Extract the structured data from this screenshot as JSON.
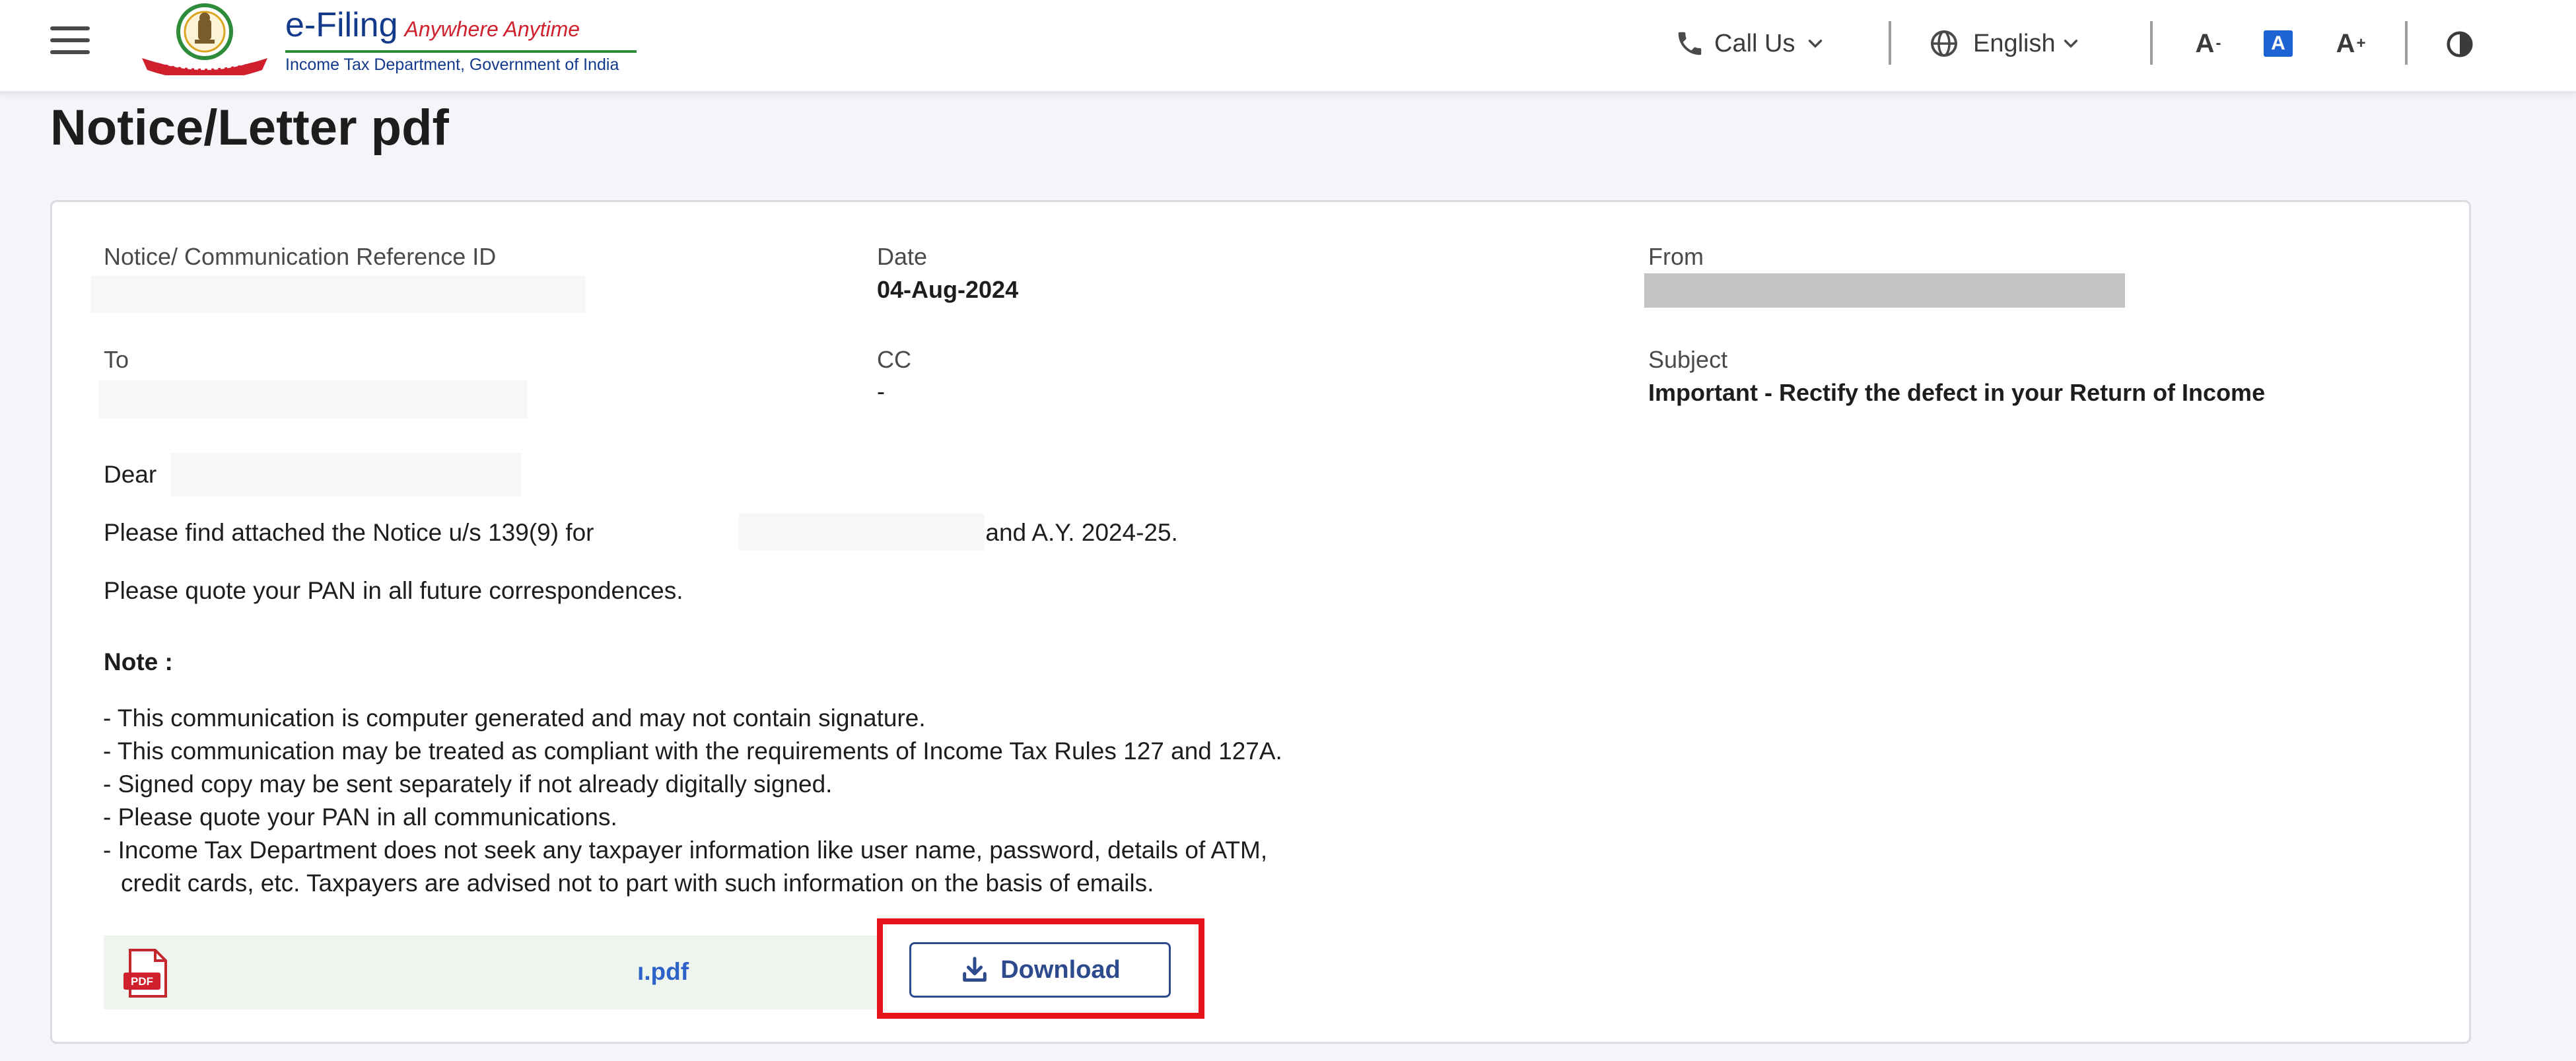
{
  "header": {
    "brand_title": "e-Filing",
    "brand_tagline": "Anywhere Anytime",
    "brand_subtitle": "Income Tax Department, Government of India",
    "call_us_label": "Call Us",
    "language_label": "English",
    "font_decrease_label": "A",
    "font_decrease_mark": "-",
    "font_normal_label": "A",
    "font_increase_label": "A",
    "font_increase_mark": "+",
    "icons": {
      "menu": "hamburger-menu-icon",
      "call": "phone-icon",
      "language": "globe-icon",
      "chevron": "chevron-down-icon",
      "contrast": "contrast-icon"
    }
  },
  "page": {
    "title": "Notice/Letter pdf"
  },
  "details": {
    "reference_label": "Notice/ Communication Reference ID",
    "date_label": "Date",
    "date_value": "04-Aug-2024",
    "from_label": "From",
    "to_label": "To",
    "cc_label": "CC",
    "cc_value": "-",
    "subject_label": "Subject",
    "subject_value": "Important - Rectify the defect in your Return of Income"
  },
  "letter": {
    "greeting": "Dear",
    "line1_prefix": "Please find attached the Notice u/s 139(9) for",
    "line1_suffix": "  and A.Y. 2024-25.",
    "line2": "Please quote your PAN in all future correspondences.",
    "note_title": "Note :",
    "notes": [
      "- This communication is computer generated and may not contain signature.",
      "- This communication may be treated as compliant with the requirements of Income Tax Rules 127 and 127A.",
      "- Signed copy may be sent separately if not already digitally signed.",
      "- Please quote your PAN in all communications.",
      "- Income Tax Department does not seek any taxpayer information like user name, password, details of ATM,"
    ],
    "note_continuation": "credit cards, etc. Taxpayers are advised not to part with such information on the basis of emails."
  },
  "attachment": {
    "file_name": "ı.pdf",
    "pdf_badge": "PDF",
    "download_label": "Download",
    "icons": {
      "file": "pdf-file-icon",
      "download": "download-icon"
    }
  },
  "colors": {
    "brand_blue": "#133a8b",
    "brand_red": "#d0202e",
    "link_blue": "#2d63c8",
    "button_navy": "#2c4a8c",
    "highlight_red": "#e8131b",
    "active_font_blue": "#1e63d3"
  }
}
